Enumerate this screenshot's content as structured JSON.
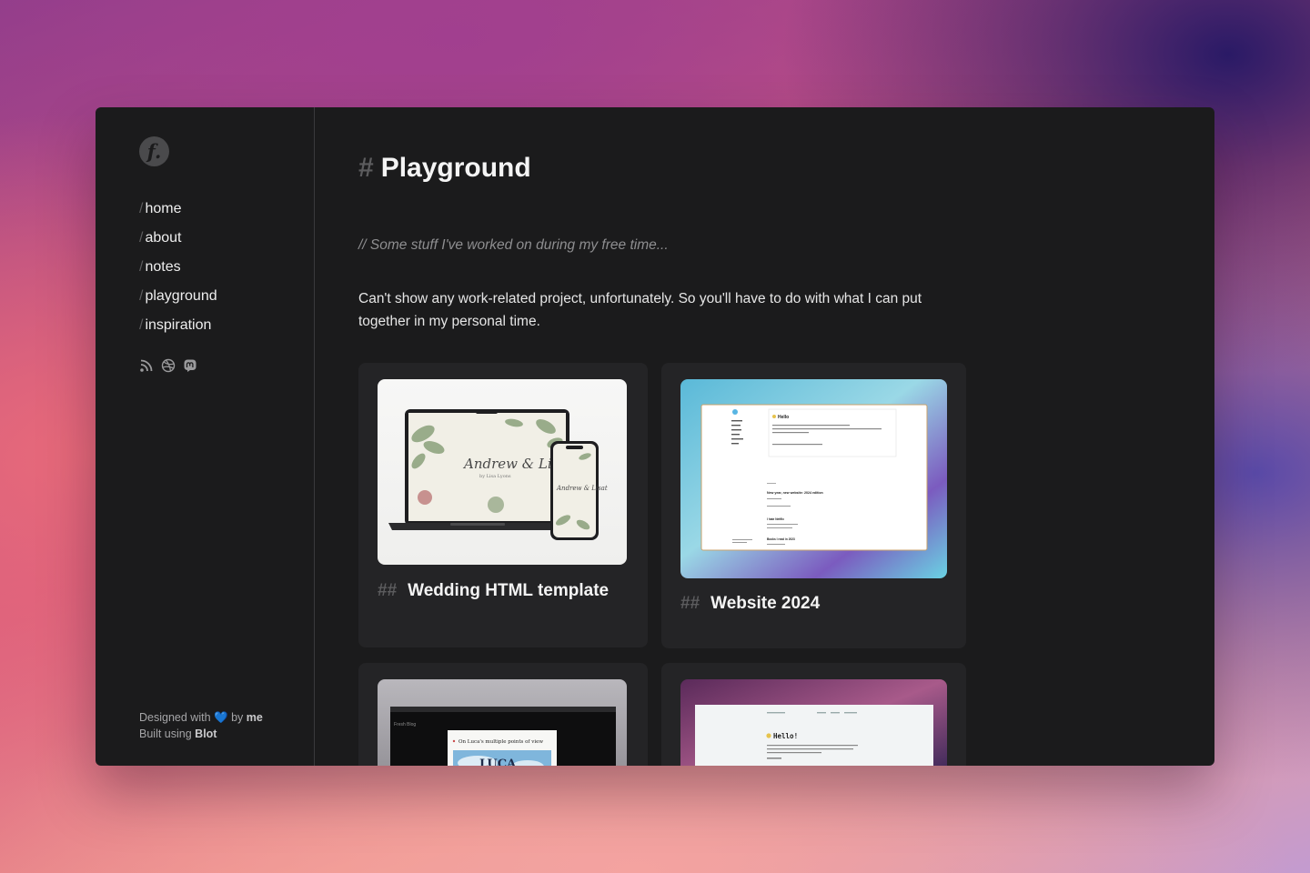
{
  "sidebar": {
    "logo": "f.",
    "nav": [
      {
        "slash": "/",
        "label": "home"
      },
      {
        "slash": "/",
        "label": "about"
      },
      {
        "slash": "/",
        "label": "notes"
      },
      {
        "slash": "/",
        "label": "playground"
      },
      {
        "slash": "/",
        "label": "inspiration"
      }
    ],
    "social_icons": [
      "rss-icon",
      "dribbble-icon",
      "mastodon-icon"
    ],
    "footer": {
      "designed_prefix": "Designed with",
      "heart": "💙",
      "by": "by",
      "me": "me",
      "built_prefix": "Built using",
      "blot": "Blot"
    }
  },
  "main": {
    "title_hash": "#",
    "title": "Playground",
    "comment": "// Some stuff I've worked on during my free time...",
    "description": "Can't show any work-related project, unfortunately. So you'll have to do with what I can put together in my personal time.",
    "cards": [
      {
        "hash": "##",
        "title": "Wedding HTML template",
        "preview": {
          "script_text": "Andrew & Lisat",
          "sub_text": "by Lisa Lyons"
        }
      },
      {
        "hash": "##",
        "title": "Website 2024",
        "preview": {
          "greeting": "Hello",
          "post_title": "New year, new website: 2024 edition",
          "post_2": "I hate Netflix",
          "post_3": "Books I read in 2023"
        }
      },
      {
        "hash": "",
        "title": "",
        "preview": {
          "headline": "On Luca's multiple points of view",
          "poster_text": "LUCA",
          "tab": "Fresh Blog"
        }
      },
      {
        "hash": "",
        "title": "",
        "preview": {
          "greeting": "Hello!"
        }
      }
    ]
  },
  "colors": {
    "window_bg": "#1b1b1c",
    "card_bg": "#242426",
    "text": "#f4f4f4",
    "muted": "#5c5c5e",
    "accent_heart": "#7ec8f0"
  }
}
